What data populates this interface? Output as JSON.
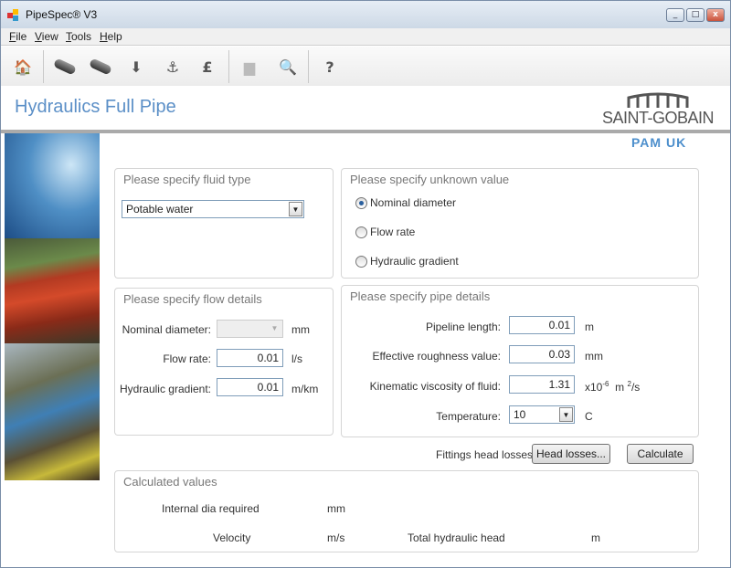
{
  "window": {
    "title": "PipeSpec® V3",
    "controls": [
      "minimize",
      "maximize",
      "close"
    ]
  },
  "menu": [
    "File",
    "View",
    "Tools",
    "Help"
  ],
  "toolbar": [
    "home-icon",
    "pipe-icon",
    "pipe-cut-icon",
    "pipe-download-icon",
    "anchor-icon",
    "pound-icon",
    "print-icon",
    "preview-icon",
    "help-icon"
  ],
  "header": {
    "title": "Hydraulics Full Pipe",
    "logo_brand": "SAINT-GOBAIN",
    "logo_sub": "PAM UK"
  },
  "fluid": {
    "title": "Please specify fluid type",
    "value": "Potable water"
  },
  "unknown": {
    "title": "Please specify unknown value",
    "options": [
      "Nominal diameter",
      "Flow rate",
      "Hydraulic gradient"
    ],
    "selected": "Nominal diameter"
  },
  "flow": {
    "title": "Please specify flow details",
    "nominal_label": "Nominal diameter:",
    "nominal_value": "",
    "nominal_unit": "mm",
    "flow_label": "Flow rate:",
    "flow_value": "0.01",
    "flow_unit": "l/s",
    "gradient_label": "Hydraulic gradient:",
    "gradient_value": "0.01",
    "gradient_unit": "m/km"
  },
  "pipe": {
    "title": "Please specify pipe details",
    "length_label": "Pipeline length:",
    "length_value": "0.01",
    "length_unit": "m",
    "rough_label": "Effective roughness value:",
    "rough_value": "0.03",
    "rough_unit": "mm",
    "visc_label": "Kinematic viscosity of fluid:",
    "visc_value": "1.31",
    "visc_unit_a": "x10",
    "visc_exp": "-6",
    "visc_unit_b": "m",
    "visc_exp2": "2",
    "visc_unit_c": "/s",
    "temp_label": "Temperature:",
    "temp_value": "10",
    "temp_unit": "C"
  },
  "actions": {
    "fittings_label": "Fittings head losses:",
    "head_losses": "Head losses...",
    "calculate": "Calculate"
  },
  "results": {
    "title": "Calculated values",
    "dia_label": "Internal dia required",
    "dia_unit": "mm",
    "vel_label": "Velocity",
    "vel_unit": "m/s",
    "head_label": "Total hydraulic head",
    "head_unit": "m"
  }
}
